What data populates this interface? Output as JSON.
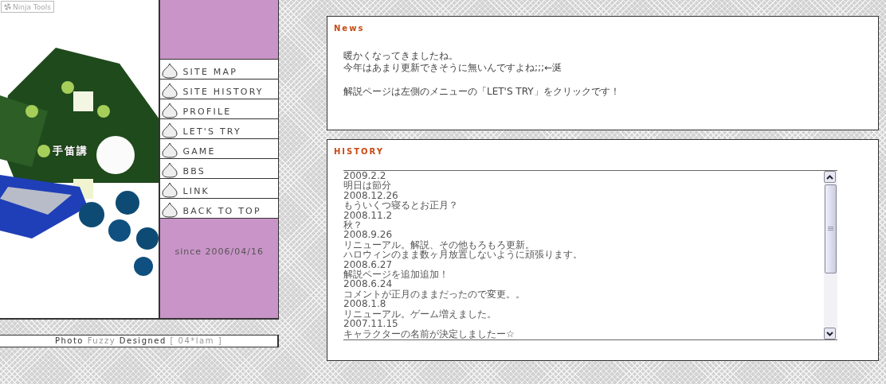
{
  "badge": {
    "label": "Ninja Tools"
  },
  "header": {
    "title": "手笛講"
  },
  "nav": {
    "items": [
      {
        "label": "SITE MAP"
      },
      {
        "label": "SITE HISTORY"
      },
      {
        "label": "PROFILE"
      },
      {
        "label": "LET'S TRY"
      },
      {
        "label": "GAME"
      },
      {
        "label": "BBS"
      },
      {
        "label": "LINK"
      },
      {
        "label": "BACK TO TOP"
      }
    ],
    "since": "since 2006/04/16"
  },
  "credit": [
    {
      "text": "Photo",
      "muted": false
    },
    {
      "text": "Fuzzy",
      "muted": true
    },
    {
      "text": "Designed",
      "muted": false
    },
    {
      "text": "[ 04*lam ]",
      "muted": true
    }
  ],
  "news": {
    "title": "News",
    "paragraphs": [
      [
        "暖かくなってきましたね。",
        "今年はあまり更新できそうに無いんですよね;;;←涎"
      ],
      [
        "解説ページは左側のメニューの「LET'S TRY」をクリックです！"
      ]
    ]
  },
  "history": {
    "title": "HISTORY",
    "lines": [
      "2009.2.2",
      "明日は節分",
      "2008.12.26",
      "もういくつ寝るとお正月？",
      "2008.11.2",
      "秋？",
      "2008.9.26",
      "リニューアル。解説、その他もろもろ更新。",
      "ハロウィンのまま数ヶ月放置しないように頑張ります。",
      "2008.6.27",
      "解説ページを追加追加！",
      "2008.6.24",
      "コメントが正月のままだったので変更。。",
      "2008.1.8",
      "リニューアル。ゲーム増えました。",
      "2007.11.15",
      "キャラクターの名前が決定しましたー☆"
    ]
  }
}
